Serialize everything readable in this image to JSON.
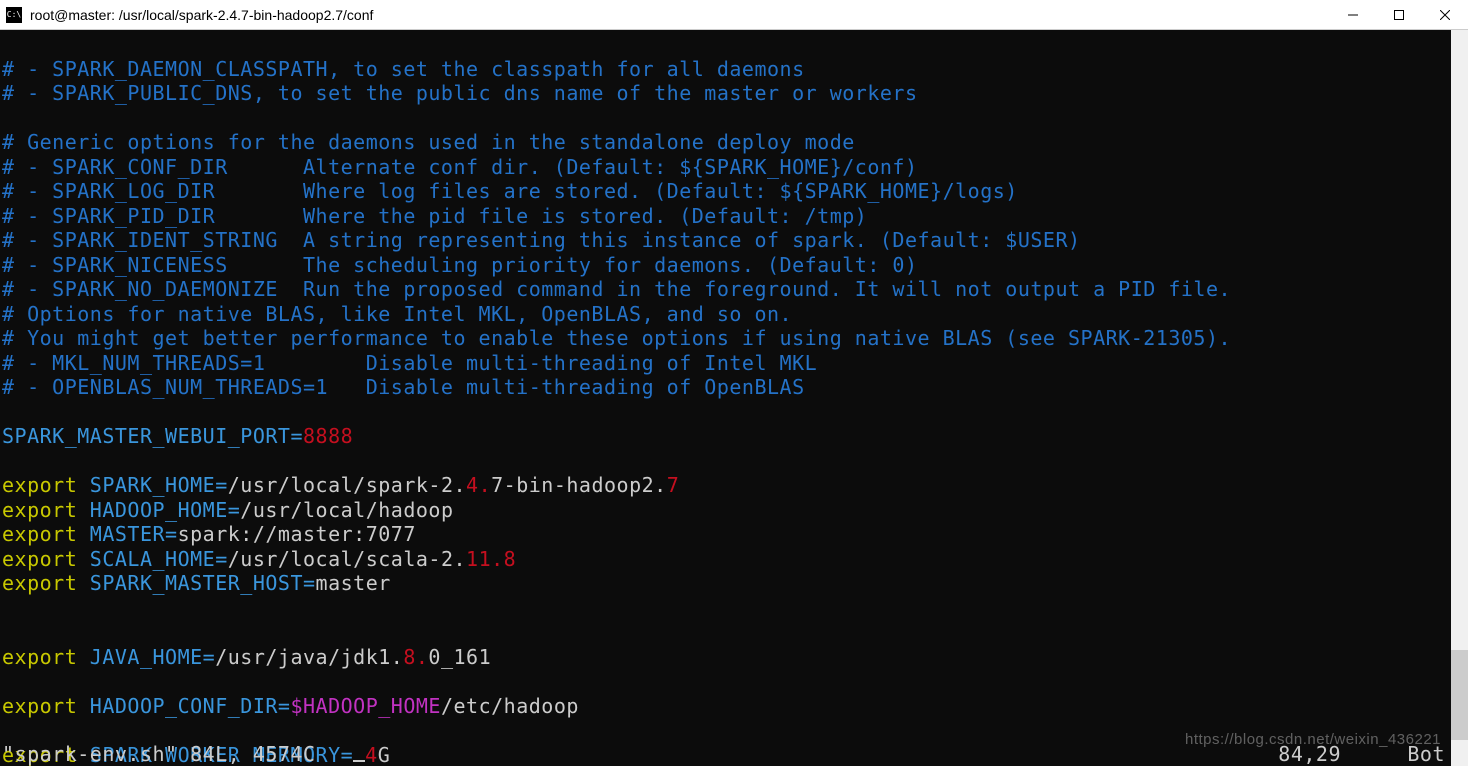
{
  "window": {
    "icon_label": "C:\\",
    "title": "root@master: /usr/local/spark-2.4.7-bin-hadoop2.7/conf"
  },
  "comments": {
    "l1": "# - SPARK_DAEMON_CLASSPATH, to set the classpath for all daemons",
    "l2": "# - SPARK_PUBLIC_DNS, to set the public dns name of the master or workers",
    "l3": "# Generic options for the daemons used in the standalone deploy mode",
    "l4": "# - SPARK_CONF_DIR      Alternate conf dir. (Default: ${SPARK_HOME}/conf)",
    "l5": "# - SPARK_LOG_DIR       Where log files are stored. (Default: ${SPARK_HOME}/logs)",
    "l6": "# - SPARK_PID_DIR       Where the pid file is stored. (Default: /tmp)",
    "l7": "# - SPARK_IDENT_STRING  A string representing this instance of spark. (Default: $USER)",
    "l8": "# - SPARK_NICENESS      The scheduling priority for daemons. (Default: 0)",
    "l9": "# - SPARK_NO_DAEMONIZE  Run the proposed command in the foreground. It will not output a PID file.",
    "l10": "# Options for native BLAS, like Intel MKL, OpenBLAS, and so on.",
    "l11": "# You might get better performance to enable these options if using native BLAS (see SPARK-21305).",
    "l12": "# - MKL_NUM_THREADS=1        Disable multi-threading of Intel MKL",
    "l13": "# - OPENBLAS_NUM_THREADS=1   Disable multi-threading of OpenBLAS"
  },
  "envs": {
    "webui_port_key": "SPARK_MASTER_WEBUI_PORT=",
    "webui_port_val": "8888",
    "export_kw": "export",
    "spark_home_key": " SPARK_HOME=",
    "spark_home_v1": "/usr/local/spark-2.",
    "spark_home_v2": "4.",
    "spark_home_v3": "7-bin-hadoop2.",
    "spark_home_v4": "7",
    "hadoop_home_key": " HADOOP_HOME=",
    "hadoop_home_val": "/usr/local/hadoop",
    "master_key": " MASTER=",
    "master_val": "spark://master:7077",
    "scala_home_key": " SCALA_HOME=",
    "scala_home_v1": "/usr/local/scala-2.",
    "scala_home_v2": "11.",
    "scala_home_v3": "8",
    "spark_master_host_key": " SPARK_MASTER_HOST=",
    "spark_master_host_val": "master",
    "java_home_key": " JAVA_HOME=",
    "java_home_v1": "/usr/java/jdk1.",
    "java_home_v2": "8.",
    "java_home_v3": "0_161",
    "hadoop_conf_key": " HADOOP_CONF_DIR=",
    "hadoop_conf_var": "$HADOOP_HOME",
    "hadoop_conf_path": "/etc/hadoop",
    "worker_mem_key": " SPARK_WORKER_MERMORY=",
    "worker_mem_v1": "4",
    "worker_mem_v2": "G"
  },
  "status": {
    "file": "\"spark-env.sh\" 84L, 4574C",
    "pos": "84,29",
    "loc": "Bot"
  },
  "watermark": "https://blog.csdn.net/weixin_436221"
}
